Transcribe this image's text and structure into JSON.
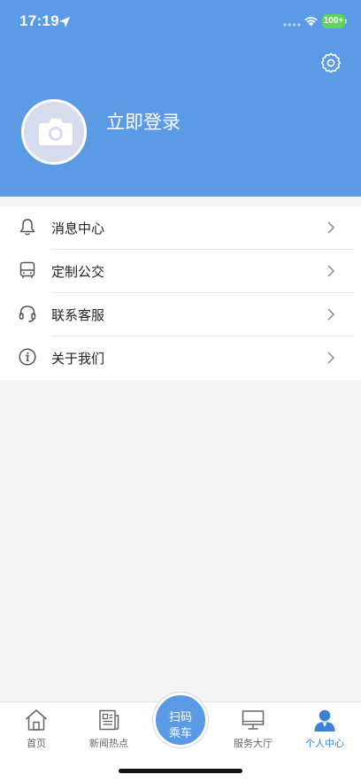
{
  "status_bar": {
    "time": "17:19",
    "battery": "100+"
  },
  "profile": {
    "login_text": "立即登录"
  },
  "menu": {
    "items": [
      {
        "label": "消息中心",
        "icon": "bell-icon"
      },
      {
        "label": "定制公交",
        "icon": "bus-icon"
      },
      {
        "label": "联系客服",
        "icon": "headset-icon"
      },
      {
        "label": "关于我们",
        "icon": "info-icon"
      }
    ]
  },
  "tabbar": {
    "tabs": [
      {
        "label": "首页",
        "icon": "home-icon"
      },
      {
        "label": "新闻热点",
        "icon": "newspaper-icon"
      },
      {
        "label": "服务大厅",
        "icon": "monitor-icon"
      },
      {
        "label": "个人中心",
        "icon": "person-icon",
        "active": true
      }
    ],
    "scan": {
      "line1": "扫码",
      "line2": "乘车"
    }
  },
  "colors": {
    "brand": "#5b9be6",
    "active_tab": "#3f7fd8",
    "battery": "#5fd35a"
  }
}
